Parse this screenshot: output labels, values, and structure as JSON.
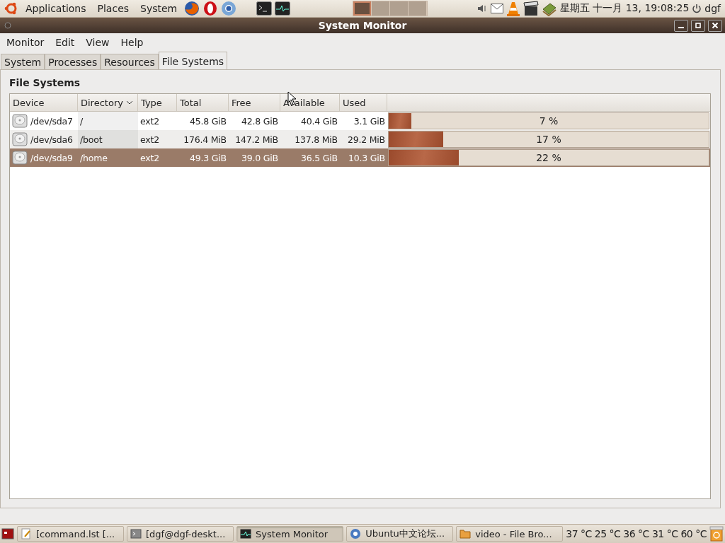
{
  "top_panel": {
    "menus": [
      "Applications",
      "Places",
      "System"
    ],
    "workspaces": [
      {
        "selected": true
      },
      {
        "selected": false
      },
      {
        "selected": false
      },
      {
        "selected": false
      }
    ],
    "clock": "星期五 十一月 13, 19:08:25",
    "user": "dgf"
  },
  "window": {
    "title": "System Monitor"
  },
  "menu_bar": [
    "Monitor",
    "Edit",
    "View",
    "Help"
  ],
  "tabs": [
    {
      "label": "System",
      "selected": false
    },
    {
      "label": "Processes",
      "selected": false
    },
    {
      "label": "Resources",
      "selected": false
    },
    {
      "label": "File Systems",
      "selected": true
    }
  ],
  "section_title": "File Systems",
  "table": {
    "columns": [
      {
        "label": "Device",
        "sorted": false
      },
      {
        "label": "Directory",
        "sorted": true
      },
      {
        "label": "Type",
        "sorted": false
      },
      {
        "label": "Total",
        "sorted": false
      },
      {
        "label": "Free",
        "sorted": false
      },
      {
        "label": "Available",
        "sorted": false
      },
      {
        "label": "Used",
        "sorted": false
      }
    ],
    "rows": [
      {
        "device": "/dev/sda7",
        "directory": "/",
        "type": "ext2",
        "total": "45.8 GiB",
        "free": "42.8 GiB",
        "available": "40.4 GiB",
        "used": "3.1 GiB",
        "level": 0.07,
        "reading": "7 %",
        "selected": false
      },
      {
        "device": "/dev/sda6",
        "directory": "/boot",
        "type": "ext2",
        "total": "176.4 MiB",
        "free": "147.2 MiB",
        "available": "137.8 MiB",
        "used": "29.2 MiB",
        "level": 0.17,
        "reading": "17 %",
        "selected": false
      },
      {
        "device": "/dev/sda9",
        "directory": "/home",
        "type": "ext2",
        "total": "49.3 GiB",
        "free": "39.0 GiB",
        "available": "36.5 GiB",
        "used": "10.3 GiB",
        "level": 0.22,
        "reading": "22 %",
        "selected": true
      }
    ]
  },
  "bottom_panel": {
    "tasks": [
      {
        "label": "[command.lst [...",
        "kind": "editor",
        "selected": false
      },
      {
        "label": "[dgf@dgf-deskt...",
        "kind": "terminal",
        "selected": false
      },
      {
        "label": "System Monitor",
        "kind": "monitor",
        "selected": true
      },
      {
        "label": "Ubuntu中文论坛...",
        "kind": "browser",
        "selected": false
      },
      {
        "label": "video - File Bro...",
        "kind": "folder",
        "selected": false
      }
    ],
    "temperatures": [
      "37 °C",
      "25 °C",
      "36 °C",
      "31 °C",
      "60 °C"
    ]
  }
}
